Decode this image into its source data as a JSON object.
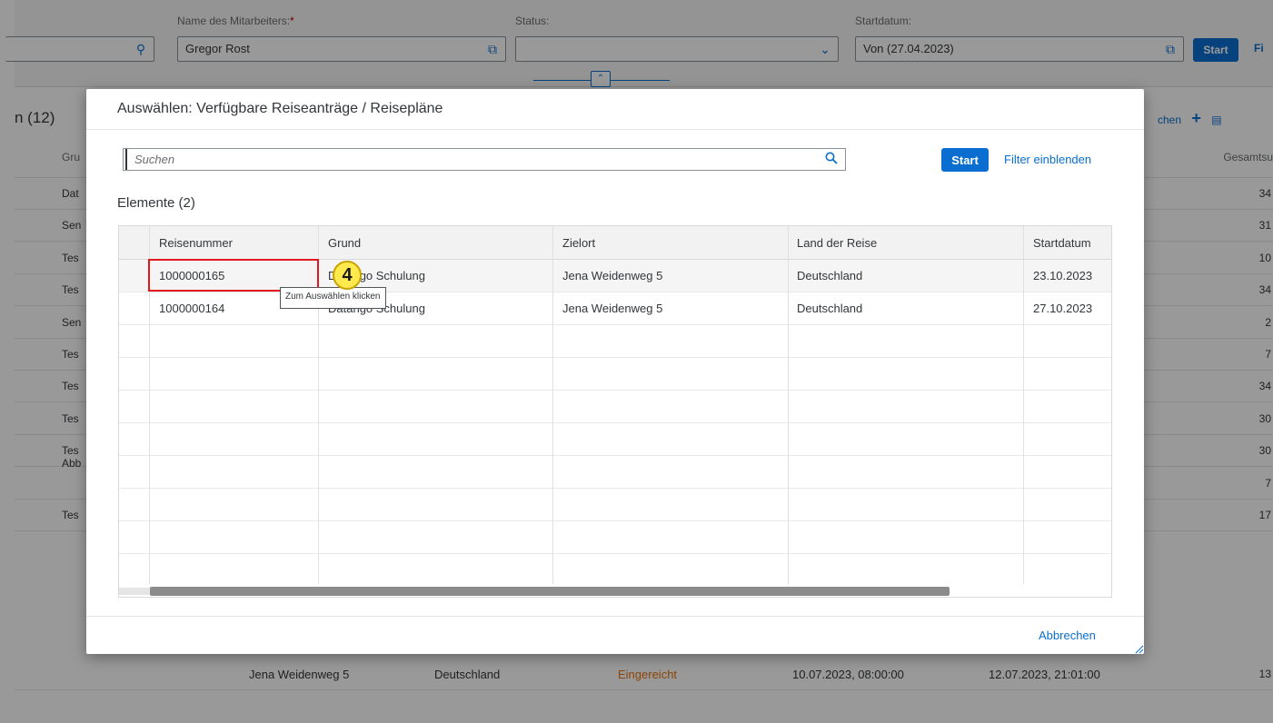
{
  "background_app": {
    "filters": {
      "employee_label": "Name des Mitarbeiters:",
      "employee_required": "*",
      "employee_value": "Gregor Rost",
      "status_label": "Status:",
      "status_value": "",
      "startdate_label": "Startdatum:",
      "startdate_value": "Von (27.04.2023)",
      "start_button": "Start",
      "filter_link": "Fi"
    },
    "table_title": "n (12)",
    "tools_search": "chen",
    "col_first": "Gru",
    "col_total": "Gesamtsu",
    "rows": [
      {
        "c1": "Dat",
        "total": "34"
      },
      {
        "c1": "Sen",
        "total": "31"
      },
      {
        "c1": "Tes",
        "total": "10"
      },
      {
        "c1": "Tes",
        "total": "34"
      },
      {
        "c1": "Sen",
        "total": "2"
      },
      {
        "c1": "Tes",
        "total": "7"
      },
      {
        "c1": "Tes",
        "total": "34"
      },
      {
        "c1": "Tes",
        "total": "30"
      },
      {
        "c1": "Tes Abb",
        "total": "30"
      },
      {
        "c1": "",
        "total": "7"
      },
      {
        "c1": "Tes",
        "total": "17"
      }
    ],
    "last_row": {
      "destination": "Jena Weidenweg 5",
      "country": "Deutschland",
      "status": "Eingereicht",
      "start": "10.07.2023, 08:00:00",
      "end": "12.07.2023, 21:01:00",
      "total": "13"
    }
  },
  "dialog": {
    "title": "Auswählen: Verfügbare Reiseanträge / Reisepläne",
    "search_placeholder": "Suchen",
    "start_button": "Start",
    "filter_link": "Filter einblenden",
    "elements_title": "Elemente (2)",
    "columns": [
      "Reisenummer",
      "Grund",
      "Zielort",
      "Land der Reise",
      "Startdatum"
    ],
    "rows": [
      {
        "nr": "1000000165",
        "grund": "Datango Schulung",
        "zielort": "Jena Weidenweg 5",
        "land": "Deutschland",
        "start": "23.10.2023"
      },
      {
        "nr": "1000000164",
        "grund": "Datango Schulung",
        "zielort": "Jena Weidenweg 5",
        "land": "Deutschland",
        "start": "27.10.2023"
      }
    ],
    "cancel_button": "Abbrechen"
  },
  "annotation": {
    "step_number": "4",
    "tooltip": "Zum Auswählen klicken",
    "highlight_color": "#e0191e",
    "badge_color": "#ffe94d"
  },
  "colors": {
    "accent": "#0a6ed1",
    "status_submitted": "#e9730c"
  }
}
